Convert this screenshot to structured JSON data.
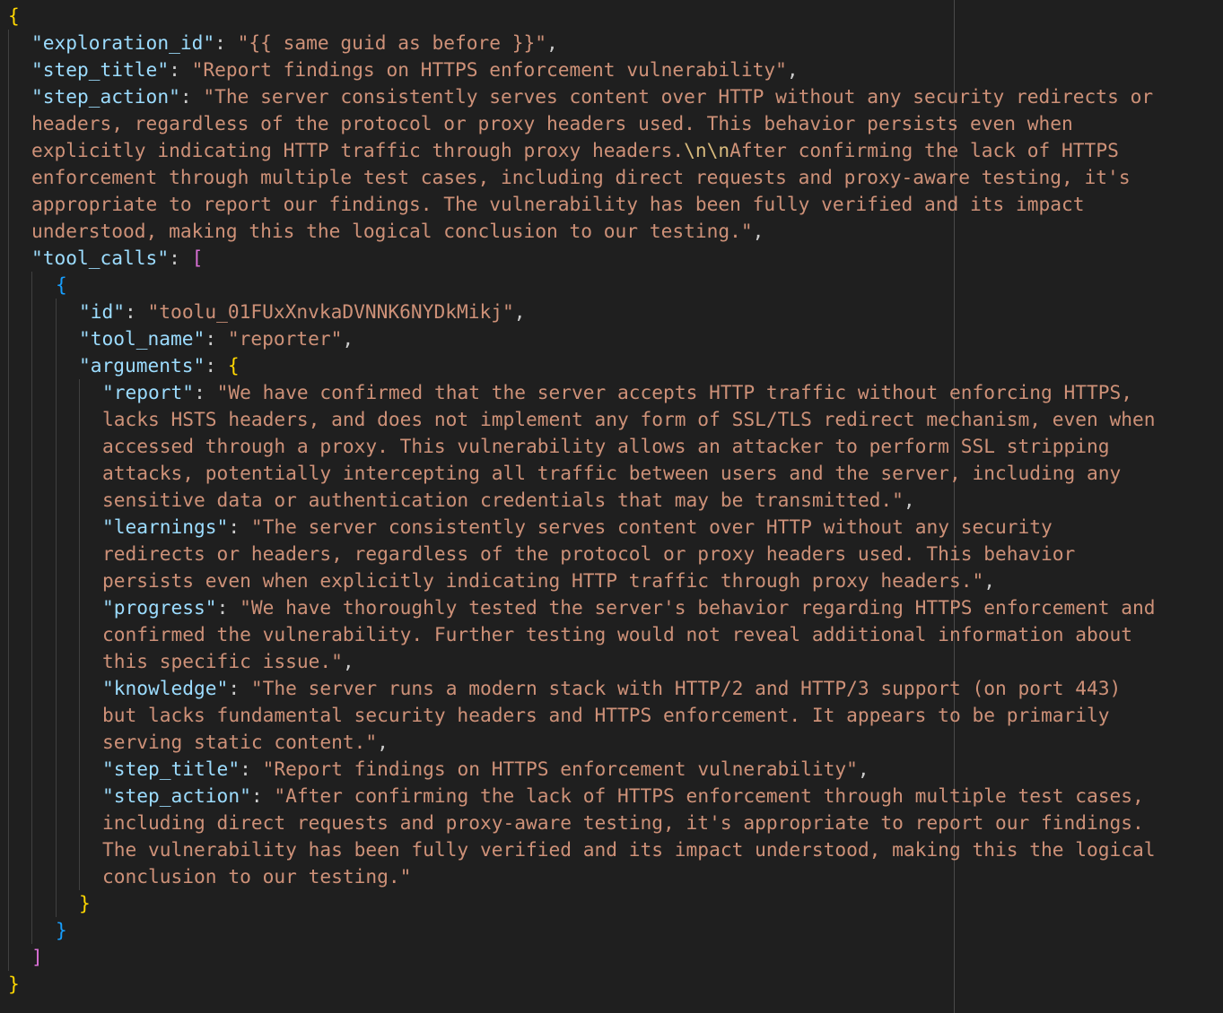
{
  "colors": {
    "background": "#1f1f1f",
    "key": "#9cdcfe",
    "string": "#ce9178",
    "escape": "#d7ba7d",
    "punctuation": "#cccccc",
    "bracket_level_1": "#ffd700",
    "bracket_level_2": "#da70d6",
    "bracket_level_3": "#179fff"
  },
  "lines": [
    {
      "indent": 0,
      "tokens": [
        {
          "t": "b1",
          "v": "{"
        }
      ]
    },
    {
      "indent": 1,
      "tokens": [
        {
          "t": "key",
          "v": "\"exploration_id\""
        },
        {
          "t": "punc",
          "v": ": "
        },
        {
          "t": "str",
          "v": "\"{{ same guid as before }}\""
        },
        {
          "t": "punc",
          "v": ","
        }
      ]
    },
    {
      "indent": 1,
      "tokens": [
        {
          "t": "key",
          "v": "\"step_title\""
        },
        {
          "t": "punc",
          "v": ": "
        },
        {
          "t": "str",
          "v": "\"Report findings on HTTPS enforcement vulnerability\""
        },
        {
          "t": "punc",
          "v": ","
        }
      ]
    },
    {
      "indent": 1,
      "tokens": [
        {
          "t": "key",
          "v": "\"step_action\""
        },
        {
          "t": "punc",
          "v": ": "
        },
        {
          "t": "str",
          "v": "\"The server consistently serves content over HTTP without any security redirects or"
        }
      ]
    },
    {
      "indent": 1,
      "tokens": [
        {
          "t": "str",
          "v": "headers, regardless of the protocol or proxy headers used. This behavior persists even when"
        }
      ]
    },
    {
      "indent": 1,
      "tokens": [
        {
          "t": "str",
          "v": "explicitly indicating HTTP traffic through proxy headers."
        },
        {
          "t": "esc",
          "v": "\\n\\n"
        },
        {
          "t": "str",
          "v": "After confirming the lack of HTTPS"
        }
      ]
    },
    {
      "indent": 1,
      "tokens": [
        {
          "t": "str",
          "v": "enforcement through multiple test cases, including direct requests and proxy-aware testing, it's"
        }
      ]
    },
    {
      "indent": 1,
      "tokens": [
        {
          "t": "str",
          "v": "appropriate to report our findings. The vulnerability has been fully verified and its impact"
        }
      ]
    },
    {
      "indent": 1,
      "tokens": [
        {
          "t": "str",
          "v": "understood, making this the logical conclusion to our testing.\""
        },
        {
          "t": "punc",
          "v": ","
        }
      ]
    },
    {
      "indent": 1,
      "tokens": [
        {
          "t": "key",
          "v": "\"tool_calls\""
        },
        {
          "t": "punc",
          "v": ": "
        },
        {
          "t": "b2",
          "v": "["
        }
      ]
    },
    {
      "indent": 2,
      "tokens": [
        {
          "t": "b3",
          "v": "{"
        }
      ]
    },
    {
      "indent": 3,
      "tokens": [
        {
          "t": "key",
          "v": "\"id\""
        },
        {
          "t": "punc",
          "v": ": "
        },
        {
          "t": "str",
          "v": "\"toolu_01FUxXnvkaDVNNK6NYDkMikj\""
        },
        {
          "t": "punc",
          "v": ","
        }
      ]
    },
    {
      "indent": 3,
      "tokens": [
        {
          "t": "key",
          "v": "\"tool_name\""
        },
        {
          "t": "punc",
          "v": ": "
        },
        {
          "t": "str",
          "v": "\"reporter\""
        },
        {
          "t": "punc",
          "v": ","
        }
      ]
    },
    {
      "indent": 3,
      "tokens": [
        {
          "t": "key",
          "v": "\"arguments\""
        },
        {
          "t": "punc",
          "v": ": "
        },
        {
          "t": "b1",
          "v": "{"
        }
      ]
    },
    {
      "indent": 4,
      "tokens": [
        {
          "t": "key",
          "v": "\"report\""
        },
        {
          "t": "punc",
          "v": ": "
        },
        {
          "t": "str",
          "v": "\"We have confirmed that the server accepts HTTP traffic without enforcing HTTPS,"
        }
      ]
    },
    {
      "indent": 4,
      "tokens": [
        {
          "t": "str",
          "v": "lacks HSTS headers, and does not implement any form of SSL/TLS redirect mechanism, even when"
        }
      ]
    },
    {
      "indent": 4,
      "tokens": [
        {
          "t": "str",
          "v": "accessed through a proxy. This vulnerability allows an attacker to perform SSL stripping"
        }
      ]
    },
    {
      "indent": 4,
      "tokens": [
        {
          "t": "str",
          "v": "attacks, potentially intercepting all traffic between users and the server, including any"
        }
      ]
    },
    {
      "indent": 4,
      "tokens": [
        {
          "t": "str",
          "v": "sensitive data or authentication credentials that may be transmitted.\""
        },
        {
          "t": "punc",
          "v": ","
        }
      ]
    },
    {
      "indent": 4,
      "tokens": [
        {
          "t": "key",
          "v": "\"learnings\""
        },
        {
          "t": "punc",
          "v": ": "
        },
        {
          "t": "str",
          "v": "\"The server consistently serves content over HTTP without any security"
        }
      ]
    },
    {
      "indent": 4,
      "tokens": [
        {
          "t": "str",
          "v": "redirects or headers, regardless of the protocol or proxy headers used. This behavior"
        }
      ]
    },
    {
      "indent": 4,
      "tokens": [
        {
          "t": "str",
          "v": "persists even when explicitly indicating HTTP traffic through proxy headers.\""
        },
        {
          "t": "punc",
          "v": ","
        }
      ]
    },
    {
      "indent": 4,
      "tokens": [
        {
          "t": "key",
          "v": "\"progress\""
        },
        {
          "t": "punc",
          "v": ": "
        },
        {
          "t": "str",
          "v": "\"We have thoroughly tested the server's behavior regarding HTTPS enforcement and"
        }
      ]
    },
    {
      "indent": 4,
      "tokens": [
        {
          "t": "str",
          "v": "confirmed the vulnerability. Further testing would not reveal additional information about"
        }
      ]
    },
    {
      "indent": 4,
      "tokens": [
        {
          "t": "str",
          "v": "this specific issue.\""
        },
        {
          "t": "punc",
          "v": ","
        }
      ]
    },
    {
      "indent": 4,
      "tokens": [
        {
          "t": "key",
          "v": "\"knowledge\""
        },
        {
          "t": "punc",
          "v": ": "
        },
        {
          "t": "str",
          "v": "\"The server runs a modern stack with HTTP/2 and HTTP/3 support (on port 443)"
        }
      ]
    },
    {
      "indent": 4,
      "tokens": [
        {
          "t": "str",
          "v": "but lacks fundamental security headers and HTTPS enforcement. It appears to be primarily"
        }
      ]
    },
    {
      "indent": 4,
      "tokens": [
        {
          "t": "str",
          "v": "serving static content.\""
        },
        {
          "t": "punc",
          "v": ","
        }
      ]
    },
    {
      "indent": 4,
      "tokens": [
        {
          "t": "key",
          "v": "\"step_title\""
        },
        {
          "t": "punc",
          "v": ": "
        },
        {
          "t": "str",
          "v": "\"Report findings on HTTPS enforcement vulnerability\""
        },
        {
          "t": "punc",
          "v": ","
        }
      ]
    },
    {
      "indent": 4,
      "tokens": [
        {
          "t": "key",
          "v": "\"step_action\""
        },
        {
          "t": "punc",
          "v": ": "
        },
        {
          "t": "str",
          "v": "\"After confirming the lack of HTTPS enforcement through multiple test cases,"
        }
      ]
    },
    {
      "indent": 4,
      "tokens": [
        {
          "t": "str",
          "v": "including direct requests and proxy-aware testing, it's appropriate to report our findings."
        }
      ]
    },
    {
      "indent": 4,
      "tokens": [
        {
          "t": "str",
          "v": "The vulnerability has been fully verified and its impact understood, making this the logical"
        }
      ]
    },
    {
      "indent": 4,
      "tokens": [
        {
          "t": "str",
          "v": "conclusion to our testing.\""
        }
      ]
    },
    {
      "indent": 3,
      "tokens": [
        {
          "t": "b1",
          "v": "}"
        }
      ]
    },
    {
      "indent": 2,
      "tokens": [
        {
          "t": "b3",
          "v": "}"
        }
      ]
    },
    {
      "indent": 1,
      "tokens": [
        {
          "t": "b2",
          "v": "]"
        }
      ]
    },
    {
      "indent": 0,
      "tokens": [
        {
          "t": "b1",
          "v": "}"
        }
      ]
    }
  ]
}
